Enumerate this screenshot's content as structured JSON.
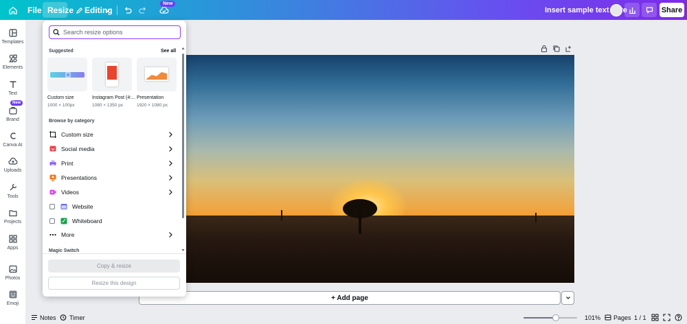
{
  "topbar": {
    "file_label": "File",
    "resize_label": "Resize",
    "editing_label": "Editing",
    "new_badge": "New",
    "insert_label": "Insert sample text here",
    "share_label": "Share"
  },
  "sidebar": {
    "items": [
      {
        "label": "Templates",
        "icon": "templates-icon"
      },
      {
        "label": "Elements",
        "icon": "elements-icon"
      },
      {
        "label": "Text",
        "icon": "text-icon"
      },
      {
        "label": "Brand",
        "icon": "brand-icon"
      },
      {
        "label": "Canva AI",
        "icon": "canva-ai-icon"
      },
      {
        "label": "Uploads",
        "icon": "uploads-icon"
      },
      {
        "label": "Tools",
        "icon": "tools-icon"
      },
      {
        "label": "Projects",
        "icon": "projects-icon"
      },
      {
        "label": "Apps",
        "icon": "apps-icon"
      },
      {
        "label": "Photos",
        "icon": "photos-icon"
      },
      {
        "label": "Emoji",
        "icon": "emoji-icon"
      }
    ],
    "brand_badge": "New"
  },
  "resize_panel": {
    "search_placeholder": "Search resize options",
    "suggested_title": "Suggested",
    "see_all": "See all",
    "suggested": [
      {
        "name": "Custom size",
        "size": "1000 × 100px"
      },
      {
        "name": "Instagram Post (4:...",
        "size": "1080 × 1350 px"
      },
      {
        "name": "Presentation",
        "size": "1920 × 1080 px"
      }
    ],
    "browse_title": "Browse by category",
    "categories": [
      {
        "label": "Custom size",
        "type": "chevron",
        "icon": "custom-size-icon",
        "color": "#0d1216"
      },
      {
        "label": "Social media",
        "type": "chevron",
        "icon": "social-media-icon",
        "color": "#e5484d"
      },
      {
        "label": "Print",
        "type": "chevron",
        "icon": "print-icon",
        "color": "#8b5cf6"
      },
      {
        "label": "Presentations",
        "type": "chevron",
        "icon": "presentations-icon",
        "color": "#f97316"
      },
      {
        "label": "Videos",
        "type": "chevron",
        "icon": "videos-icon",
        "color": "#d946ef"
      },
      {
        "label": "Website",
        "type": "checkbox",
        "icon": "website-icon",
        "color": "#6366f1"
      },
      {
        "label": "Whiteboard",
        "type": "checkbox",
        "icon": "whiteboard-icon",
        "color": "#16a34a"
      },
      {
        "label": "More",
        "type": "chevron",
        "icon": "more-icon",
        "color": "#0d1216"
      }
    ],
    "magic_title": "Magic Switch",
    "copy_resize_label": "Copy & resize",
    "resize_design_label": "Resize this design"
  },
  "canvas": {
    "add_page_label": "+ Add page"
  },
  "bottombar": {
    "notes_label": "Notes",
    "timer_label": "Timer",
    "zoom_label": "101%",
    "zoom_level": 0.6,
    "pages_label": "Pages",
    "page_count": "1 / 1"
  },
  "colors": {
    "accent": "#8b3dff",
    "topbar_start": "#00c4cc",
    "topbar_end": "#7d2ae8"
  }
}
